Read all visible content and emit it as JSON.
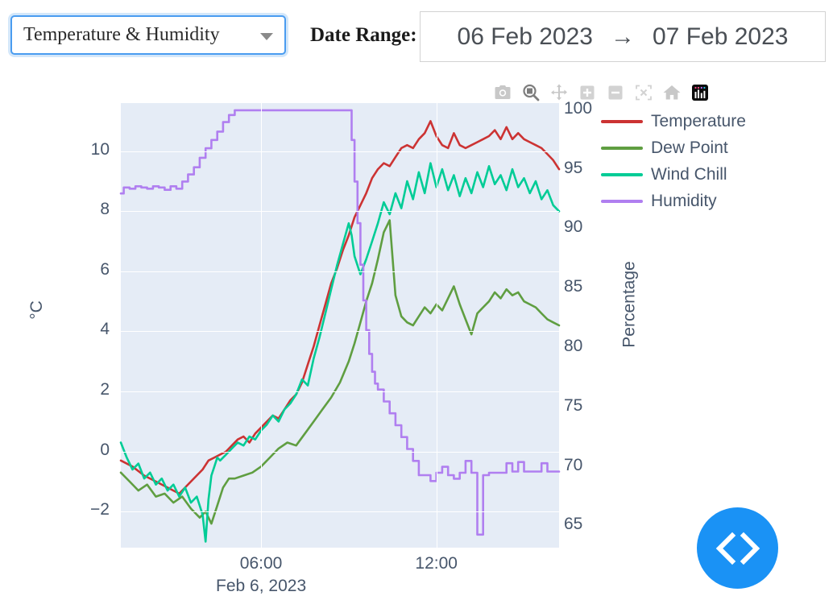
{
  "header": {
    "series_select": {
      "value": "Temperature & Humidity",
      "caret_icon": "chevron-down-icon"
    },
    "date_range": {
      "label": "Date Range:",
      "start": "06 Feb 2023",
      "arrow": "→",
      "end": "07 Feb 2023"
    }
  },
  "modebar": {
    "buttons": [
      {
        "name": "download-plot-icon",
        "title": "Download plot as a png"
      },
      {
        "name": "zoom-icon",
        "title": "Zoom"
      },
      {
        "name": "pan-icon",
        "title": "Pan"
      },
      {
        "name": "zoom-in-icon",
        "title": "Zoom in"
      },
      {
        "name": "zoom-out-icon",
        "title": "Zoom out"
      },
      {
        "name": "autoscale-icon",
        "title": "Autoscale"
      },
      {
        "name": "reset-axes-icon",
        "title": "Reset axes"
      },
      {
        "name": "plotly-logo-icon",
        "title": "Produced with Plotly"
      }
    ]
  },
  "fab": {
    "name": "prev-next-nav-button",
    "icon": "code-chevrons-icon"
  },
  "chart_data": {
    "type": "line",
    "title": "",
    "xlabel": "Feb 6, 2023",
    "ylabel": "°C",
    "y2label": "Percentage",
    "grid": true,
    "legend_position": "right",
    "plot_bgcolor": "#e5ecf6",
    "gridcolor": "#ffffff",
    "xlim_labels": [
      "06:00",
      "12:00"
    ],
    "x_ticks": [
      "06:00",
      "12:00"
    ],
    "x_tick_positions_hours": [
      6,
      12
    ],
    "x_range_hours": [
      1.2,
      16.2
    ],
    "ylim": [
      -3.2,
      11.6
    ],
    "y_ticks": [
      10,
      8,
      6,
      4,
      2,
      0,
      -2
    ],
    "y2lim": [
      63.2,
      100.6
    ],
    "y2_ticks": [
      100,
      95,
      90,
      85,
      80,
      75,
      70,
      65
    ],
    "colors": {
      "temperature": "#cc3333",
      "dew_point": "#5f9e41",
      "wind_chill": "#00cc96",
      "humidity": "#b07ff0"
    },
    "series": [
      {
        "name": "Temperature",
        "axis": "y",
        "unit": "°C",
        "color": "#cc3333",
        "x_hours": [
          1.2,
          1.6,
          2.0,
          2.4,
          2.8,
          3.2,
          3.6,
          4.0,
          4.2,
          4.4,
          4.6,
          4.8,
          5.0,
          5.2,
          5.4,
          5.6,
          5.8,
          6.0,
          6.2,
          6.4,
          6.6,
          6.8,
          7.0,
          7.2,
          7.4,
          7.6,
          7.8,
          8.0,
          8.2,
          8.4,
          8.6,
          8.8,
          9.0,
          9.2,
          9.4,
          9.6,
          9.8,
          10.0,
          10.2,
          10.4,
          10.6,
          10.8,
          11.0,
          11.2,
          11.4,
          11.6,
          11.8,
          12.0,
          12.2,
          12.4,
          12.6,
          12.8,
          13.0,
          13.2,
          13.4,
          13.6,
          13.8,
          14.0,
          14.2,
          14.4,
          14.6,
          14.8,
          15.0,
          15.2,
          15.4,
          15.6,
          15.8,
          16.0,
          16.2
        ],
        "values": [
          -0.3,
          -0.5,
          -0.8,
          -1.0,
          -1.2,
          -1.4,
          -1.0,
          -0.6,
          -0.3,
          -0.2,
          -0.1,
          0.0,
          0.2,
          0.4,
          0.5,
          0.3,
          0.6,
          0.8,
          1.0,
          1.2,
          1.1,
          1.4,
          1.7,
          1.9,
          2.3,
          2.9,
          3.5,
          4.2,
          4.9,
          5.6,
          6.1,
          6.7,
          7.2,
          7.8,
          8.2,
          8.6,
          9.1,
          9.4,
          9.6,
          9.5,
          9.8,
          10.1,
          10.2,
          10.1,
          10.4,
          10.6,
          11.0,
          10.5,
          10.2,
          10.1,
          10.6,
          10.2,
          10.1,
          10.2,
          10.3,
          10.4,
          10.5,
          10.7,
          10.4,
          10.8,
          10.4,
          10.6,
          10.4,
          10.3,
          10.2,
          10.1,
          9.9,
          9.7,
          9.4
        ]
      },
      {
        "name": "Dew Point",
        "axis": "y",
        "unit": "°C",
        "color": "#5f9e41",
        "x_hours": [
          1.2,
          1.5,
          1.8,
          2.1,
          2.4,
          2.7,
          3.0,
          3.3,
          3.6,
          3.9,
          4.1,
          4.3,
          4.5,
          4.7,
          4.9,
          5.1,
          5.4,
          5.7,
          6.0,
          6.3,
          6.6,
          6.9,
          7.2,
          7.5,
          7.8,
          8.1,
          8.4,
          8.7,
          9.0,
          9.2,
          9.4,
          9.6,
          9.8,
          10.0,
          10.2,
          10.4,
          10.6,
          10.8,
          11.0,
          11.2,
          11.4,
          11.6,
          11.8,
          12.0,
          12.2,
          12.4,
          12.6,
          12.8,
          13.0,
          13.2,
          13.4,
          13.6,
          13.8,
          14.0,
          14.2,
          14.4,
          14.6,
          14.8,
          15.0,
          15.2,
          15.4,
          15.6,
          15.8,
          16.0,
          16.2
        ],
        "values": [
          -0.7,
          -1.0,
          -1.3,
          -1.1,
          -1.5,
          -1.4,
          -1.7,
          -1.5,
          -1.9,
          -2.2,
          -2.0,
          -2.4,
          -1.8,
          -1.2,
          -0.9,
          -0.9,
          -0.8,
          -0.7,
          -0.5,
          -0.2,
          0.1,
          0.3,
          0.2,
          0.6,
          1.0,
          1.4,
          1.8,
          2.3,
          3.0,
          3.6,
          4.3,
          5.0,
          5.6,
          6.4,
          7.3,
          7.7,
          5.2,
          4.5,
          4.3,
          4.2,
          4.5,
          4.8,
          4.6,
          4.9,
          4.7,
          5.1,
          5.5,
          4.9,
          4.4,
          3.9,
          4.6,
          4.8,
          5.0,
          5.3,
          5.1,
          5.4,
          5.2,
          5.3,
          5.0,
          4.9,
          4.8,
          4.6,
          4.4,
          4.3,
          4.2
        ]
      },
      {
        "name": "Wind Chill",
        "axis": "y",
        "unit": "°C",
        "color": "#00cc96",
        "x_hours": [
          1.2,
          1.4,
          1.6,
          1.8,
          2.0,
          2.2,
          2.4,
          2.6,
          2.8,
          3.0,
          3.2,
          3.4,
          3.6,
          3.8,
          4.0,
          4.1,
          4.2,
          4.3,
          4.4,
          4.5,
          4.6,
          4.8,
          5.0,
          5.2,
          5.4,
          5.6,
          5.8,
          6.0,
          6.2,
          6.4,
          6.6,
          6.8,
          7.0,
          7.2,
          7.4,
          7.6,
          7.8,
          8.0,
          8.2,
          8.4,
          8.6,
          8.8,
          9.0,
          9.1,
          9.2,
          9.4,
          9.6,
          9.8,
          10.0,
          10.2,
          10.4,
          10.6,
          10.8,
          11.0,
          11.2,
          11.4,
          11.6,
          11.8,
          12.0,
          12.2,
          12.4,
          12.6,
          12.8,
          13.0,
          13.2,
          13.4,
          13.6,
          13.8,
          14.0,
          14.2,
          14.4,
          14.6,
          14.8,
          15.0,
          15.2,
          15.4,
          15.6,
          15.8,
          16.0,
          16.2
        ],
        "values": [
          0.3,
          -0.2,
          -0.6,
          -0.4,
          -0.9,
          -0.7,
          -1.1,
          -0.9,
          -1.3,
          -1.1,
          -1.5,
          -1.2,
          -1.7,
          -1.5,
          -2.1,
          -3.0,
          -1.6,
          -0.8,
          -0.5,
          -0.2,
          -0.3,
          -0.1,
          0.1,
          0.3,
          0.2,
          0.5,
          0.4,
          0.7,
          0.9,
          1.2,
          1.0,
          1.4,
          1.6,
          1.9,
          2.4,
          2.2,
          3.1,
          3.8,
          4.6,
          5.4,
          6.2,
          6.9,
          7.6,
          7.2,
          6.5,
          5.9,
          6.4,
          7.0,
          7.6,
          8.3,
          7.9,
          8.6,
          8.1,
          9.0,
          8.4,
          9.3,
          8.6,
          9.6,
          8.8,
          9.4,
          8.7,
          9.2,
          8.5,
          9.1,
          8.6,
          9.3,
          8.8,
          9.5,
          8.9,
          9.2,
          8.7,
          9.4,
          8.8,
          9.1,
          8.6,
          9.0,
          8.4,
          8.7,
          8.2,
          8.0
        ]
      },
      {
        "name": "Humidity",
        "axis": "y2",
        "unit": "%",
        "color": "#b07ff0",
        "x_hours": [
          1.2,
          1.3,
          1.5,
          1.7,
          1.9,
          2.1,
          2.3,
          2.5,
          2.7,
          2.9,
          3.1,
          3.3,
          3.5,
          3.7,
          3.9,
          4.1,
          4.3,
          4.5,
          4.7,
          4.9,
          5.1,
          5.3,
          5.5,
          5.7,
          5.9,
          6.1,
          6.5,
          7.0,
          7.5,
          8.0,
          8.5,
          9.0,
          9.1,
          9.2,
          9.3,
          9.4,
          9.5,
          9.6,
          9.7,
          9.8,
          9.9,
          10.0,
          10.2,
          10.4,
          10.6,
          10.8,
          11.0,
          11.2,
          11.4,
          11.6,
          11.8,
          12.0,
          12.2,
          12.4,
          12.6,
          12.8,
          13.0,
          13.2,
          13.4,
          13.6,
          13.8,
          14.0,
          14.2,
          14.4,
          14.6,
          14.8,
          15.0,
          15.2,
          15.4,
          15.6,
          15.8,
          16.0,
          16.2
        ],
        "values": [
          93,
          93.5,
          93.4,
          93.6,
          93.5,
          93.4,
          93.6,
          93.5,
          93.3,
          93.6,
          93.4,
          94.0,
          94.6,
          95.2,
          96.0,
          96.8,
          97.5,
          98.2,
          99.0,
          99.6,
          100,
          100,
          100,
          100,
          100,
          100,
          100,
          100,
          100,
          100,
          100,
          100,
          97.5,
          94.0,
          90.5,
          87.0,
          84.0,
          81.5,
          79.5,
          78.0,
          77.0,
          76.5,
          75.5,
          74.5,
          73.5,
          72.5,
          71.5,
          70.5,
          69.3,
          69.3,
          68.8,
          69.5,
          70.0,
          69.3,
          69.0,
          69.5,
          70.5,
          69.5,
          64.3,
          69.3,
          69.5,
          69.5,
          69.5,
          70.3,
          69.6,
          70.4,
          69.6,
          69.6,
          69.6,
          70.3,
          69.6,
          69.6,
          69.6
        ]
      }
    ]
  }
}
